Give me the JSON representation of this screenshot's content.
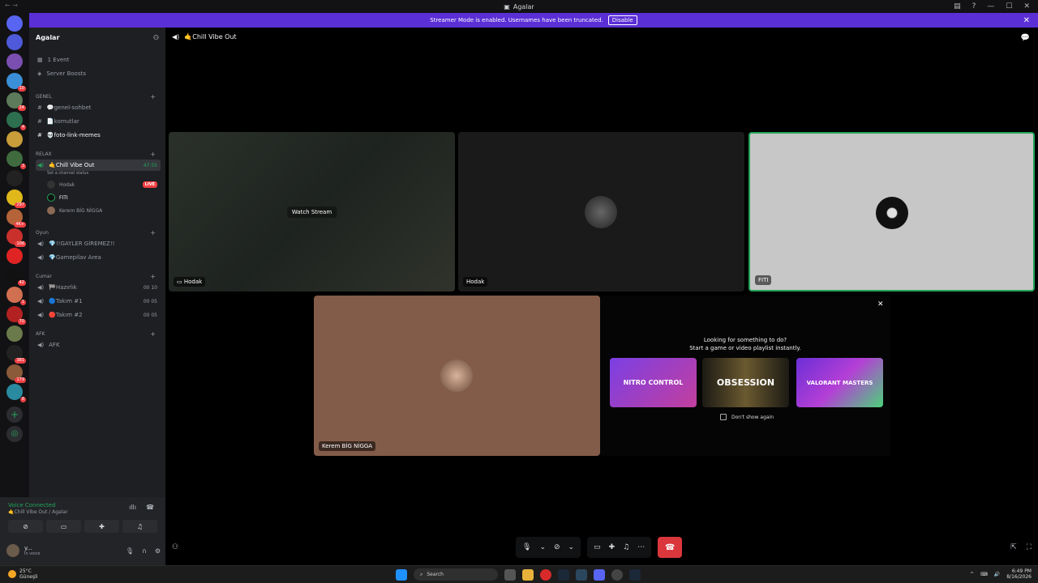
{
  "window": {
    "title": "Agalar"
  },
  "banner": {
    "text": "Streamer Mode is enabled. Usernames have been truncated.",
    "disable_label": "Disable"
  },
  "guilds": [
    {
      "color": "#4e5ad9",
      "badge": ""
    },
    {
      "color": "#7a4fb0",
      "badge": ""
    },
    {
      "color": "#3a8fd8",
      "badge": "10"
    },
    {
      "color": "#5d7a5a",
      "badge": "24"
    },
    {
      "color": "#2d6f4f",
      "badge": "4"
    },
    {
      "color": "#c89d3a",
      "badge": ""
    },
    {
      "color": "#3f6b3f",
      "badge": "3"
    },
    {
      "color": "#222222",
      "badge": ""
    },
    {
      "color": "#e0b81a",
      "badge": "297"
    },
    {
      "color": "#b5643a",
      "badge": "4K+"
    },
    {
      "color": "#c9302c",
      "badge": "106"
    },
    {
      "color": "#e02424",
      "badge": ""
    },
    {
      "color": "#111111",
      "badge": "42"
    },
    {
      "color": "#d07050",
      "badge": "1"
    },
    {
      "color": "#b22222",
      "badge": "70"
    },
    {
      "color": "#6b7a4a",
      "badge": ""
    },
    {
      "color": "#222222",
      "badge": "381"
    },
    {
      "color": "#8a5a3a",
      "badge": "179"
    },
    {
      "color": "#2a8aa0",
      "badge": "8"
    }
  ],
  "server": {
    "name": "Agalar",
    "items": {
      "events": "1 Event",
      "boosts": "Server Boosts"
    },
    "categories": {
      "genel": "GENEL",
      "relax": "RELAX",
      "oyun": "Oyun",
      "cumar": "Cumar",
      "afk": "AFK"
    },
    "channels": {
      "genel_sohbet": "💬genel-sohbet",
      "komutlar": "📄komutlar",
      "foto": "💀foto-link-memes",
      "chill": "🤙Chill Vibe Out",
      "chill_time": "47:55",
      "chill_status": "Set a channel status",
      "gayler": "💎!!GAYLER GİREMEZ!!",
      "gamepilav": "💎Gamepilav Area",
      "hazirlik": "🏁Hazırlık",
      "hazirlik_count": "00 10",
      "takim1": "🔵Takım #1",
      "takim1_count": "00 05",
      "takim2": "🔴Takım #2",
      "takim2_count": "00 05",
      "afk": "AFK"
    },
    "members": [
      {
        "name": "Hodak",
        "live": "LIVE"
      },
      {
        "name": "FITI",
        "live": ""
      },
      {
        "name": "Kerem BİG NİGGA",
        "live": ""
      }
    ]
  },
  "voice": {
    "status": "Voice Connected",
    "location": "🤙Chill Vibe Out / Agalar"
  },
  "user": {
    "name": "y...",
    "status": "In voice"
  },
  "call": {
    "channel_name": "🤙Chill Vibe Out",
    "watch_stream": "Watch Stream",
    "tiles": {
      "stream_label": "Hodak",
      "hodak_label": "Hodak",
      "fiti_label": "FITI",
      "kerem_label": "Kerem BİG NİGGA"
    }
  },
  "activity": {
    "line1": "Looking for something to do?",
    "line2": "Start a game or video playlist instantly.",
    "cards": [
      "NITRO CONTROL",
      "OBSESSION",
      "VALORANT MASTERS"
    ],
    "dont_show": "Don't show again"
  },
  "taskbar": {
    "temp": "25°C",
    "weather": "Güneşli",
    "search": "Search",
    "time": "6:49 PM",
    "date": "8/16/2026"
  },
  "colors": {
    "accent": "#5b2fd6",
    "connected": "#23a55a",
    "hangup": "#da373c",
    "fiti_tile": "#c7c7c7",
    "kerem_tile": "#835c49"
  }
}
